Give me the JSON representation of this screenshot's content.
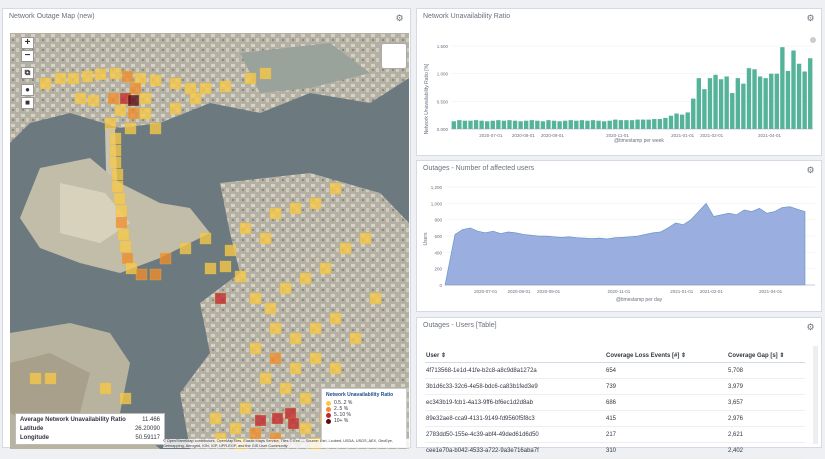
{
  "map_panel": {
    "title": "Network Outage Map (new)",
    "icons": [
      "gear-icon",
      "zoom-in-icon",
      "zoom-out-icon",
      "fit-bounds-icon",
      "draw-icon",
      "layers-icon"
    ],
    "legend": {
      "title": "Network Unavailability Ratio",
      "items": [
        {
          "label": "0.5..2 %",
          "color": "#f7c948"
        },
        {
          "label": "2..5 %",
          "color": "#f08c2a"
        },
        {
          "label": "5..10 %",
          "color": "#c1272d"
        },
        {
          "label": "10+ %",
          "color": "#5a0a14"
        }
      ]
    },
    "info": {
      "rows": [
        {
          "label": "Average Network Unavailability Ratio",
          "value": "11.466"
        },
        {
          "label": "Latitude",
          "value": "26.20090"
        },
        {
          "label": "Longitude",
          "value": "50.59117"
        }
      ]
    },
    "attribution": "© OpenStreetMap contributors, OpenMapTiles, Elastic Maps Service, Tiles © Esri — Source: Esri, i-cubed, USDA, USGS, AEX, GeoEye, Getmapping, Aerogrid, IGN, IGP, UPR-EGP, and the GIS User Community"
  },
  "ratio_panel": {
    "title": "Network Unavailability Ratio",
    "ylabel": "Network Unavailability Ratio [%]",
    "xlabel": "@timestamp per week",
    "yticks": [
      "0.000",
      "0.500",
      "1.000",
      "1.500"
    ],
    "xticks": [
      "2020-07-01",
      "2020-08-01",
      "2020-09-01",
      "2020-11-01",
      "2021-01-01",
      "2021-02-01",
      "2021-04-01"
    ]
  },
  "users_panel": {
    "title": "Outages - Number of affected users",
    "ylabel": "Users",
    "xlabel": "@timestamp per day",
    "yticks": [
      "0",
      "200",
      "400",
      "600",
      "800",
      "1,000",
      "1,200"
    ],
    "xticks": [
      "2020-07-01",
      "2020-08-01",
      "2020-09-01",
      "2020-11-01",
      "2021-01-01",
      "2021-02-01",
      "2021-04-01"
    ]
  },
  "table_panel": {
    "title": "Outages - Users [Table]",
    "columns": [
      "User",
      "Coverage Loss Events [#]",
      "Coverage Gap [s]"
    ],
    "rows": [
      [
        "4f713568-1e1d-41fe-b2c8-a8c9d8a1272a",
        "654",
        "5,708"
      ],
      [
        "3b1d6c33-32c6-4e58-bdc6-ca83b1fed3e9",
        "739",
        "3,979"
      ],
      [
        "ec343b19-fcb1-4a13-9ff6-bf6ec1d2d8ab",
        "686",
        "3,657"
      ],
      [
        "89e32ae8-cca9-4131-9149-fd9560f5f8c3",
        "415",
        "2,976"
      ],
      [
        "2783dd50-155e-4c39-abf4-49ded61d6d50",
        "217",
        "2,621"
      ],
      [
        "cee1e70a-b042-4533-a722-9a3e716aba7f",
        "310",
        "2,402"
      ]
    ]
  },
  "chart_data": [
    {
      "type": "bar",
      "title": "Network Unavailability Ratio",
      "xlabel": "@timestamp per week",
      "ylabel": "Network Unavailability Ratio [%]",
      "ylim": [
        0,
        1.7
      ],
      "color": "#54b399",
      "values": [
        0.14,
        0.16,
        0.15,
        0.15,
        0.16,
        0.15,
        0.14,
        0.15,
        0.16,
        0.15,
        0.16,
        0.15,
        0.14,
        0.15,
        0.16,
        0.15,
        0.14,
        0.16,
        0.15,
        0.14,
        0.15,
        0.16,
        0.15,
        0.16,
        0.15,
        0.16,
        0.15,
        0.14,
        0.15,
        0.17,
        0.16,
        0.16,
        0.16,
        0.17,
        0.17,
        0.17,
        0.18,
        0.18,
        0.2,
        0.24,
        0.28,
        0.26,
        0.3,
        0.55,
        0.92,
        0.72,
        0.92,
        0.98,
        0.9,
        0.95,
        0.65,
        0.92,
        0.82,
        1.1,
        1.08,
        0.95,
        0.92,
        1.0,
        1.0,
        1.48,
        1.05,
        1.42,
        1.18,
        1.04,
        1.28
      ]
    },
    {
      "type": "area",
      "title": "Outages - Number of affected users",
      "xlabel": "@timestamp per day",
      "ylabel": "Users",
      "ylim": [
        0,
        1250
      ],
      "color": "#6092c0",
      "values": [
        620,
        680,
        700,
        660,
        640,
        660,
        630,
        650,
        640,
        620,
        610,
        600,
        600,
        590,
        585,
        590,
        580,
        575,
        570,
        575,
        565,
        580,
        585,
        590,
        600,
        620,
        640,
        650,
        700,
        760,
        740,
        800,
        900,
        1000,
        840,
        860,
        880,
        860,
        920,
        900,
        940,
        880,
        900,
        950,
        960,
        930,
        900
      ]
    }
  ]
}
